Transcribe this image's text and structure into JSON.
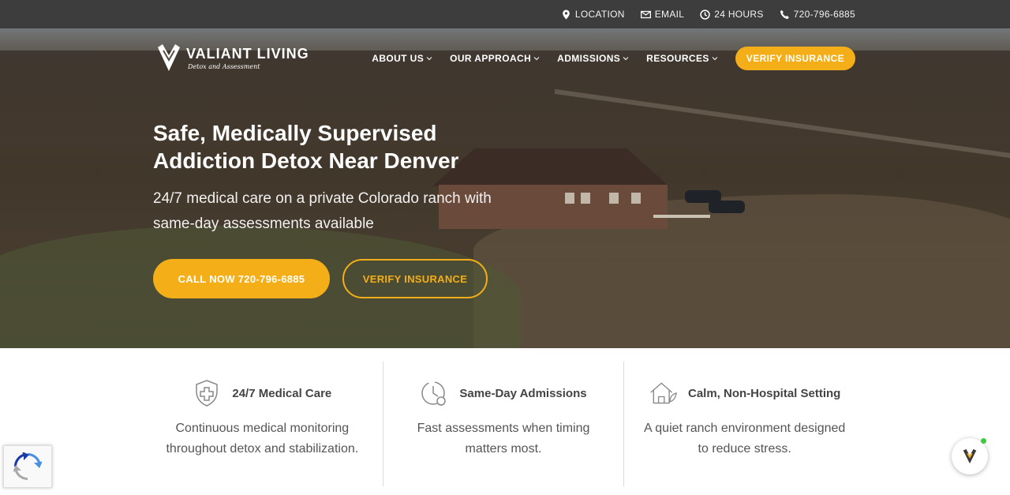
{
  "topbar": {
    "location": "LOCATION",
    "email": "EMAIL",
    "hours": "24 HOURS",
    "phone": "720-796-6885"
  },
  "brand": {
    "name": "VALIANT LIVING",
    "tagline": "Detox and Assessment"
  },
  "nav": {
    "items": [
      "ABOUT US",
      "OUR APPROACH",
      "ADMISSIONS",
      "RESOURCES"
    ],
    "cta": "VERIFY INSURANCE"
  },
  "hero": {
    "title": "Safe, Medically Supervised Addiction Detox Near Denver",
    "subtitle": "24/7 medical care on a private Colorado ranch with same-day assessments available",
    "call_button": "CALL NOW 720-796-6885",
    "verify_button": "VERIFY INSURANCE"
  },
  "features": [
    {
      "title": "24/7 Medical Care",
      "desc": "Continuous medical monitoring throughout detox and stabilization.",
      "icon": "shield-cross-icon"
    },
    {
      "title": "Same-Day Admissions",
      "desc": "Fast assessments when timing matters most.",
      "icon": "clock-icon"
    },
    {
      "title": "Calm, Non-Hospital Setting",
      "desc": "A quiet ranch environment designed to reduce stress.",
      "icon": "house-leaf-icon"
    }
  ],
  "colors": {
    "accent": "#f4ae17",
    "topbar": "#3d3d3d"
  }
}
